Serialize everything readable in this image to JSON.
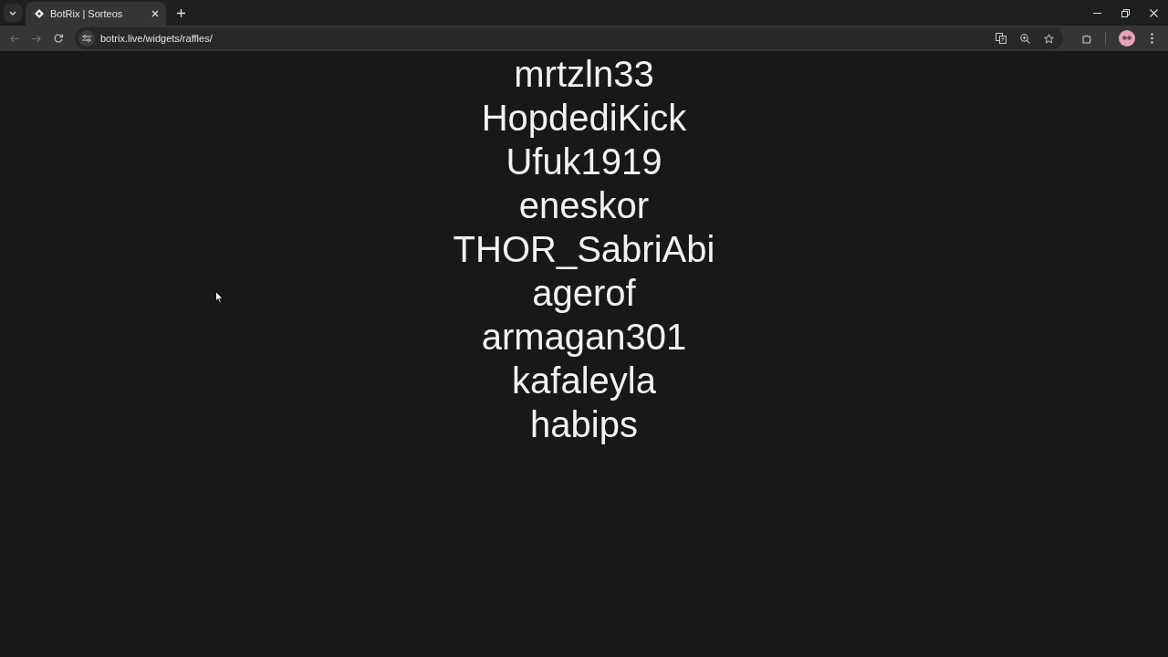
{
  "browser": {
    "tabs": [
      {
        "title": "BotRix | Sorteos",
        "selected": true
      }
    ],
    "address_bar": {
      "url": "botrix.live/widgets/raffles/"
    }
  },
  "raffle_list": {
    "entries": [
      "mrtzln33",
      "HopdediKick",
      "Ufuk1919",
      "eneskor",
      "THOR_SabriAbi",
      "agerof",
      "armagan301",
      "kafaleyla",
      "habips"
    ]
  }
}
